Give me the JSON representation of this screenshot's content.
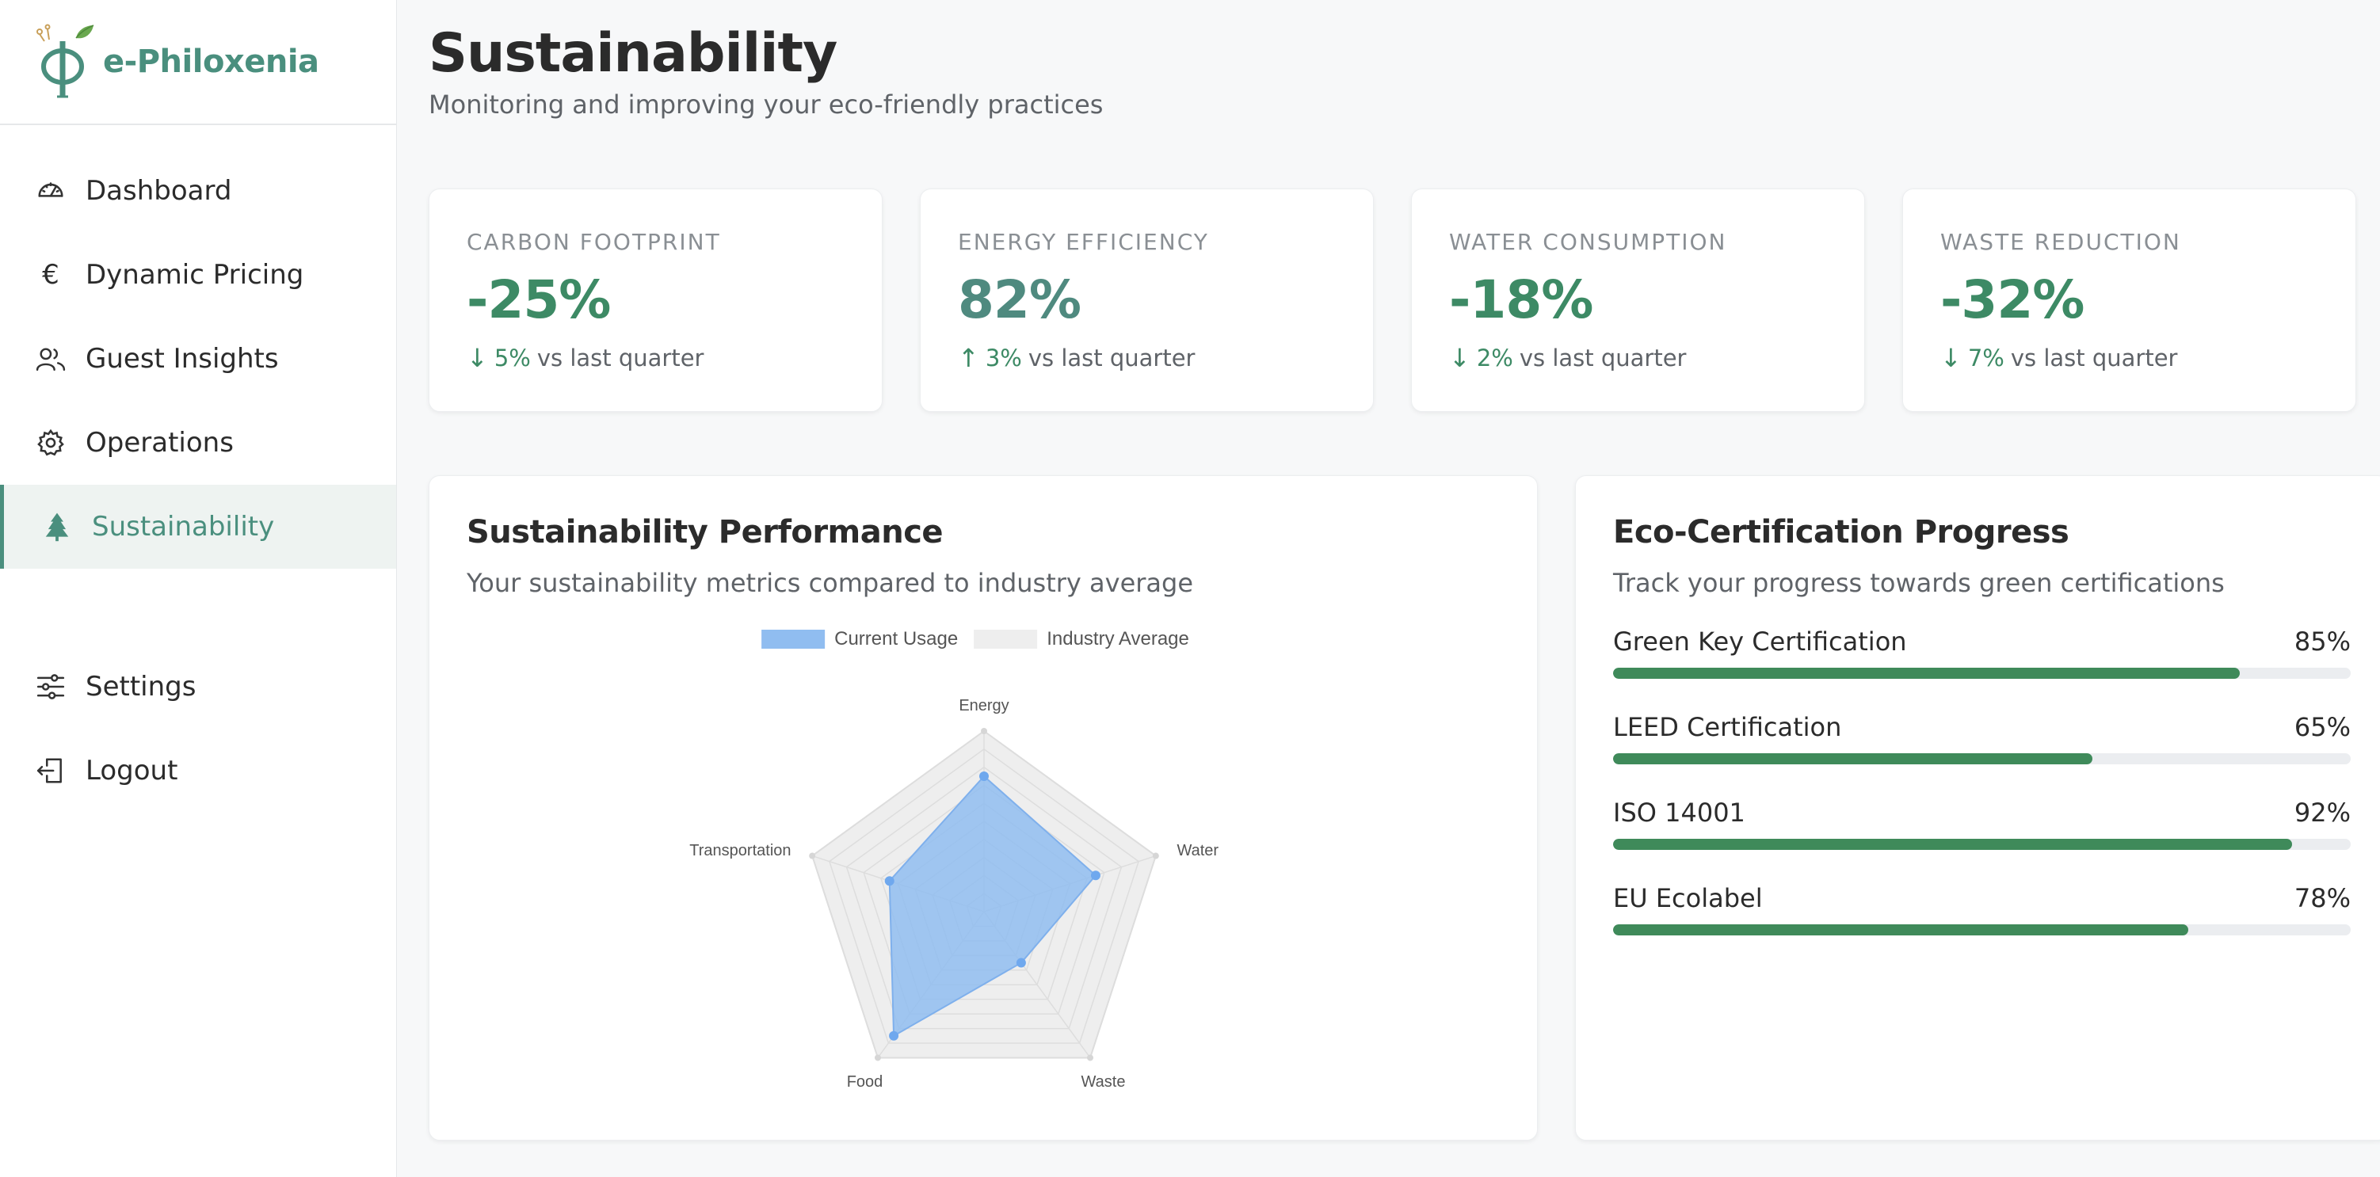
{
  "app": {
    "name": "e-Philoxenia"
  },
  "sidebar": {
    "items": [
      {
        "label": "Dashboard",
        "icon": "gauge-icon"
      },
      {
        "label": "Dynamic Pricing",
        "icon": "euro-icon"
      },
      {
        "label": "Guest Insights",
        "icon": "users-icon"
      },
      {
        "label": "Operations",
        "icon": "gear-icon"
      },
      {
        "label": "Sustainability",
        "icon": "tree-icon",
        "active": true
      }
    ],
    "bottom_items": [
      {
        "label": "Settings",
        "icon": "sliders-icon"
      },
      {
        "label": "Logout",
        "icon": "logout-icon"
      }
    ]
  },
  "header": {
    "title": "Sustainability",
    "subtitle": "Monitoring and improving your eco-friendly practices"
  },
  "stats": [
    {
      "label": "CARBON FOOTPRINT",
      "value": "-25%",
      "direction": "down",
      "change": "5%",
      "suffix": "vs last quarter"
    },
    {
      "label": "ENERGY EFFICIENCY",
      "value": "82%",
      "direction": "up",
      "change": "3%",
      "suffix": "vs last quarter"
    },
    {
      "label": "WATER CONSUMPTION",
      "value": "-18%",
      "direction": "down",
      "change": "2%",
      "suffix": "vs last quarter"
    },
    {
      "label": "WASTE REDUCTION",
      "value": "-32%",
      "direction": "down",
      "change": "7%",
      "suffix": "vs last quarter"
    }
  ],
  "performance": {
    "title": "Sustainability Performance",
    "subtitle": "Your sustainability metrics compared to industry average"
  },
  "chart_data": {
    "type": "radar",
    "categories": [
      "Energy",
      "Water",
      "Waste",
      "Food",
      "Transportation"
    ],
    "series": [
      {
        "name": "Current Usage",
        "values": [
          75,
          65,
          35,
          85,
          55
        ],
        "color": "#90bdf0"
      },
      {
        "name": "Industry Average",
        "values": [
          100,
          100,
          100,
          100,
          100
        ],
        "color": "#eeeeee"
      }
    ],
    "range": [
      0,
      100
    ],
    "legend_position": "top"
  },
  "certifications": {
    "title": "Eco-Certification Progress",
    "subtitle": "Track your progress towards green certifications",
    "items": [
      {
        "name": "Green Key Certification",
        "percent_label": "85%",
        "progress": 0.85
      },
      {
        "name": "LEED Certification",
        "percent_label": "65%",
        "progress": 0.65
      },
      {
        "name": "ISO 14001",
        "percent_label": "92%",
        "progress": 0.92
      },
      {
        "name": "EU Ecolabel",
        "percent_label": "78%",
        "progress": 0.78
      }
    ]
  },
  "colors": {
    "brand": "#4a8f7e",
    "positive": "#3d8a65",
    "progress": "#3f8a5a"
  }
}
